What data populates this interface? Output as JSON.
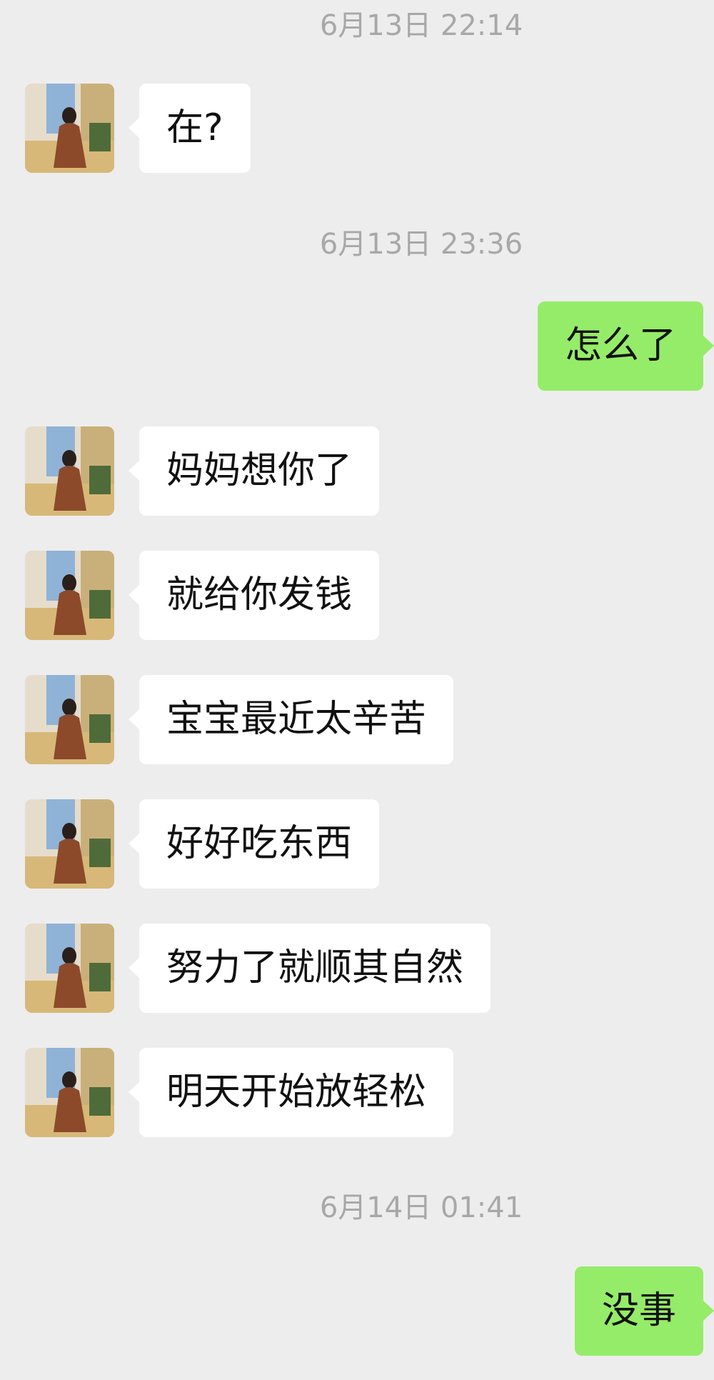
{
  "timestamps": [
    "6月13日 22:14",
    "6月13日 23:36",
    "6月14日 01:41"
  ],
  "messages": [
    {
      "side": "in",
      "text": "在?"
    },
    {
      "side": "out",
      "text": "怎么了"
    },
    {
      "side": "in",
      "text": "妈妈想你了"
    },
    {
      "side": "in",
      "text": "就给你发钱"
    },
    {
      "side": "in",
      "text": "宝宝最近太辛苦"
    },
    {
      "side": "in",
      "text": "好好吃东西"
    },
    {
      "side": "in",
      "text": "努力了就顺其自然"
    },
    {
      "side": "in",
      "text": "明天开始放轻松"
    },
    {
      "side": "out",
      "text": "没事"
    }
  ],
  "colors": {
    "background": "#ededed",
    "incoming_bubble": "#ffffff",
    "outgoing_bubble": "#95ec69",
    "timestamp_text": "#a8a8a8"
  },
  "avatar_icon": "contact-photo-avatar"
}
